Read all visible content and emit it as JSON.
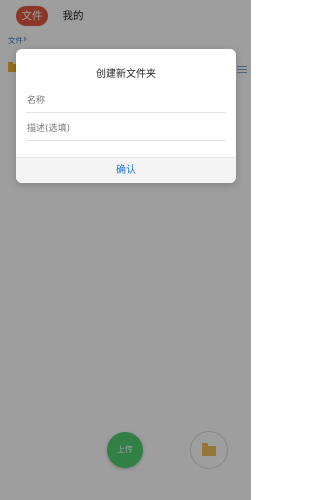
{
  "tabs": {
    "files": "文件",
    "mine": "我的"
  },
  "breadcrumb": {
    "current": "文件"
  },
  "fab": {
    "upload_label": "上传"
  },
  "dialog": {
    "title": "创建新文件夹",
    "name_placeholder": "名称",
    "description_placeholder": "描述(选填)",
    "confirm_label": "确认"
  },
  "colors": {
    "active_tab": "#e0573f",
    "link_blue": "#2f80d1",
    "upload_green": "#4fcf70",
    "folder_yellow": "#f1b331"
  },
  "icons": {
    "folder": "folder-icon",
    "list_view": "list-view-icon"
  }
}
